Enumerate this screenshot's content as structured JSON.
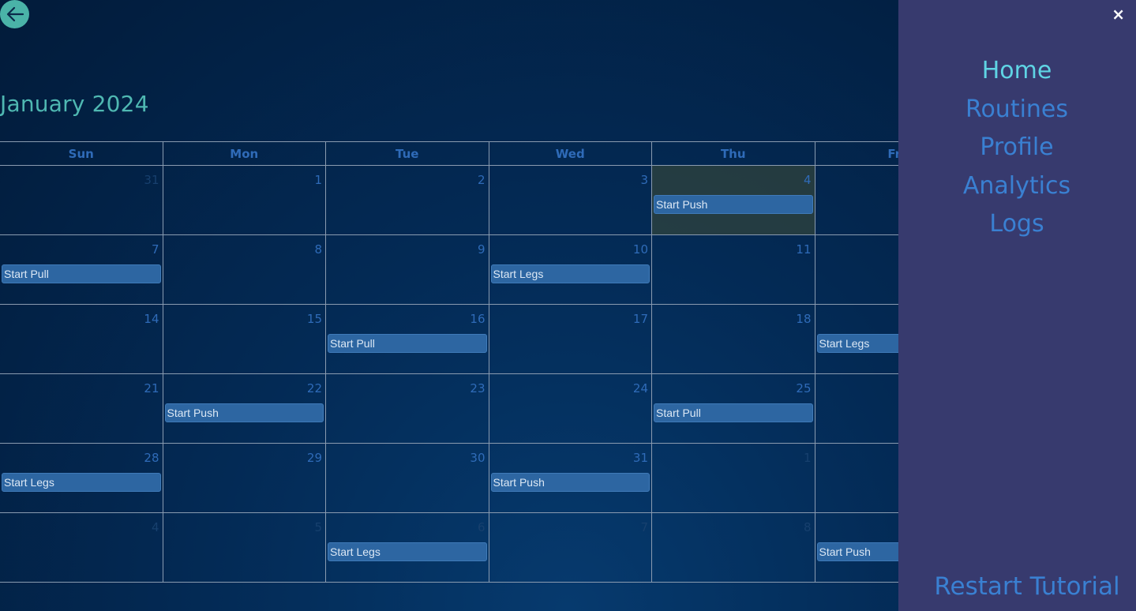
{
  "header": {
    "back_icon": "arrow-left-icon",
    "month_title": "January 2024"
  },
  "calendar": {
    "weekdays": [
      "Sun",
      "Mon",
      "Tue",
      "Wed",
      "Thu",
      "Fri"
    ],
    "weeks": [
      [
        {
          "day": "31",
          "other": true,
          "event": ""
        },
        {
          "day": "1",
          "other": false,
          "event": ""
        },
        {
          "day": "2",
          "other": false,
          "event": ""
        },
        {
          "day": "3",
          "other": false,
          "event": ""
        },
        {
          "day": "4",
          "other": false,
          "event": "Start Push",
          "today": true
        },
        {
          "day": "",
          "other": false,
          "event": ""
        }
      ],
      [
        {
          "day": "7",
          "other": false,
          "event": "Start Pull"
        },
        {
          "day": "8",
          "other": false,
          "event": ""
        },
        {
          "day": "9",
          "other": false,
          "event": ""
        },
        {
          "day": "10",
          "other": false,
          "event": "Start Legs"
        },
        {
          "day": "11",
          "other": false,
          "event": ""
        },
        {
          "day": "",
          "other": false,
          "event": ""
        }
      ],
      [
        {
          "day": "14",
          "other": false,
          "event": ""
        },
        {
          "day": "15",
          "other": false,
          "event": ""
        },
        {
          "day": "16",
          "other": false,
          "event": "Start Pull"
        },
        {
          "day": "17",
          "other": false,
          "event": ""
        },
        {
          "day": "18",
          "other": false,
          "event": ""
        },
        {
          "day": "",
          "other": false,
          "event": "Start Legs"
        }
      ],
      [
        {
          "day": "21",
          "other": false,
          "event": ""
        },
        {
          "day": "22",
          "other": false,
          "event": "Start Push"
        },
        {
          "day": "23",
          "other": false,
          "event": ""
        },
        {
          "day": "24",
          "other": false,
          "event": ""
        },
        {
          "day": "25",
          "other": false,
          "event": "Start Pull"
        },
        {
          "day": "",
          "other": false,
          "event": ""
        }
      ],
      [
        {
          "day": "28",
          "other": false,
          "event": "Start Legs"
        },
        {
          "day": "29",
          "other": false,
          "event": ""
        },
        {
          "day": "30",
          "other": false,
          "event": ""
        },
        {
          "day": "31",
          "other": false,
          "event": "Start Push"
        },
        {
          "day": "1",
          "other": true,
          "event": ""
        },
        {
          "day": "",
          "other": false,
          "event": ""
        }
      ],
      [
        {
          "day": "4",
          "other": true,
          "event": ""
        },
        {
          "day": "5",
          "other": true,
          "event": ""
        },
        {
          "day": "6",
          "other": true,
          "event": "Start Legs"
        },
        {
          "day": "7",
          "other": true,
          "event": ""
        },
        {
          "day": "8",
          "other": true,
          "event": ""
        },
        {
          "day": "",
          "other": false,
          "event": "Start Push"
        }
      ]
    ]
  },
  "sidebar": {
    "close_label": "×",
    "items": [
      {
        "label": "Home",
        "active": true
      },
      {
        "label": "Routines",
        "active": false
      },
      {
        "label": "Profile",
        "active": false
      },
      {
        "label": "Analytics",
        "active": false
      },
      {
        "label": "Logs",
        "active": false
      }
    ],
    "restart_label": "Restart Tutorial"
  },
  "colors": {
    "accent": "#4fb8b2",
    "event_bg": "#2d66a2",
    "sidebar_bg": "#373a6e",
    "nav_active": "#5fd4e4",
    "nav_item": "#3a80d2"
  }
}
